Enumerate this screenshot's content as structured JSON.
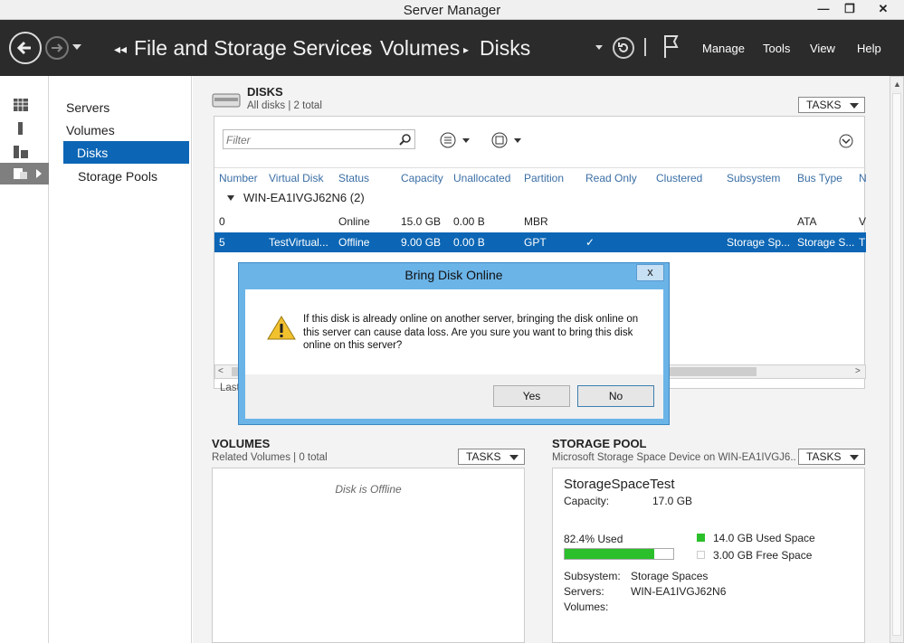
{
  "window": {
    "title": "Server Manager",
    "minimize": "—",
    "restore": "❐",
    "close": "✕"
  },
  "nav": {
    "breadcrumb": [
      "File and Storage Services",
      "Volumes",
      "Disks"
    ],
    "menu": [
      "Manage",
      "Tools",
      "View",
      "Help"
    ]
  },
  "sidebar": {
    "items": [
      {
        "label": "Servers"
      },
      {
        "label": "Volumes"
      },
      {
        "label": "Disks"
      },
      {
        "label": "Storage Pools"
      }
    ]
  },
  "disks": {
    "heading": "DISKS",
    "subtitle": "All disks | 2 total",
    "tasks_label": "TASKS",
    "filter_placeholder": "Filter",
    "columns": [
      "Number",
      "Virtual Disk",
      "Status",
      "Capacity",
      "Unallocated",
      "Partition",
      "Read Only",
      "Clustered",
      "Subsystem",
      "Bus Type",
      "N"
    ],
    "group": "WIN-EA1IVGJ62N6 (2)",
    "rows": [
      {
        "number": "0",
        "virtual": "",
        "status": "Online",
        "capacity": "15.0 GB",
        "unallocated": "0.00 B",
        "partition": "MBR",
        "readonly": "",
        "clustered": "",
        "subsystem": "",
        "bustype": "ATA",
        "n": "V"
      },
      {
        "number": "5",
        "virtual": "TestVirtual...",
        "status": "Offline",
        "capacity": "9.00 GB",
        "unallocated": "0.00 B",
        "partition": "GPT",
        "readonly": "✓",
        "clustered": "",
        "subsystem": "Storage Sp...",
        "bustype": "Storage S...",
        "n": "T"
      }
    ],
    "last_refreshed": "Last"
  },
  "dialog": {
    "title": "Bring Disk Online",
    "close": "x",
    "message": "If this disk is already online on another server, bringing the disk online on this server can cause data loss. Are you sure you want to bring this disk online on this server?",
    "yes": "Yes",
    "no": "No"
  },
  "volumes": {
    "heading": "VOLUMES",
    "subtitle": "Related Volumes | 0 total",
    "tasks_label": "TASKS",
    "empty": "Disk is Offline"
  },
  "pool": {
    "heading": "STORAGE POOL",
    "subtitle": "Microsoft Storage Space Device on WIN-EA1IVGJ6...",
    "tasks_label": "TASKS",
    "name": "StorageSpaceTest",
    "capacity_label": "Capacity:",
    "capacity": "17.0 GB",
    "used_pct_label": "82.4% Used",
    "used_fraction": 0.824,
    "used_space": "14.0 GB Used Space",
    "free_space": "3.00 GB Free Space",
    "subsystem_label": "Subsystem:",
    "subsystem": "Storage Spaces",
    "servers_label": "Servers:",
    "servers": "WIN-EA1IVGJ62N6",
    "volumes_label": "Volumes:"
  },
  "colors": {
    "selection": "#0c66b5",
    "used_bar": "#2bbf2b",
    "nav_bg": "#2b2b2b",
    "dialog_frame": "#6bb4e8"
  }
}
